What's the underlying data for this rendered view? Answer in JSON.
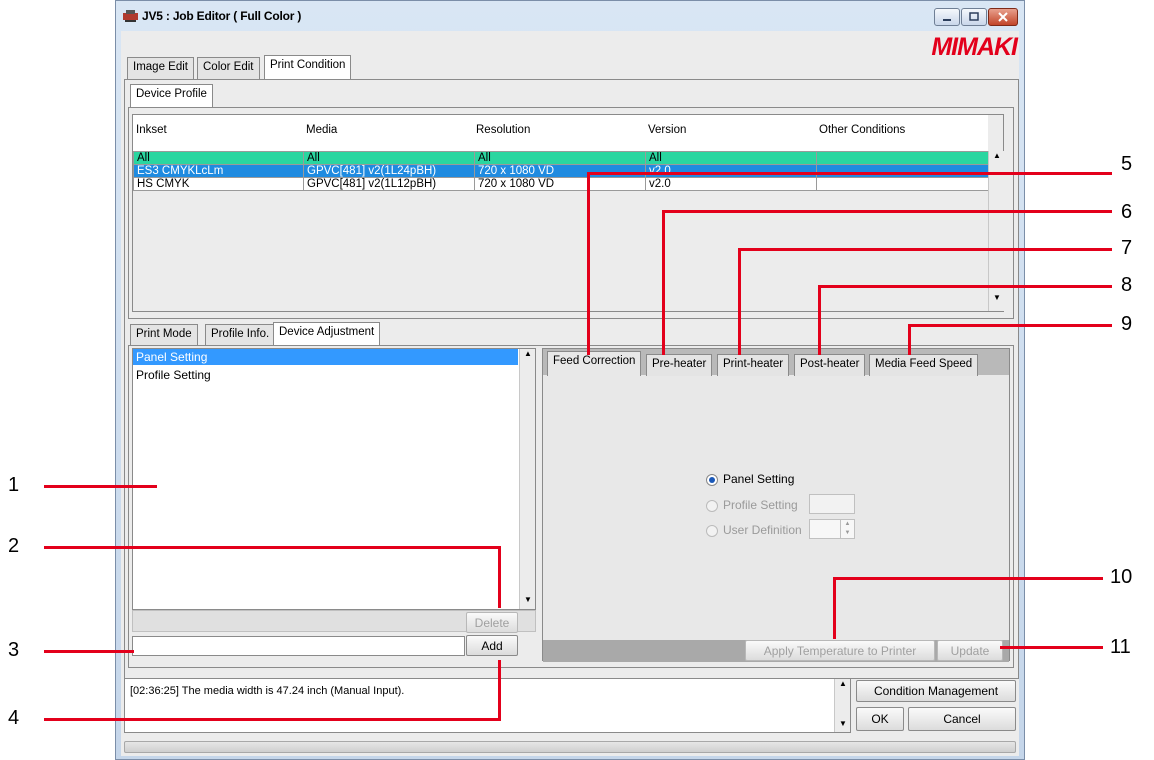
{
  "window": {
    "title": "JV5 : Job Editor ( Full Color )",
    "logo": "MIMAKI"
  },
  "main_tabs": [
    {
      "label": "Image Edit"
    },
    {
      "label": "Color Edit"
    },
    {
      "label": "Print Condition"
    }
  ],
  "sub_tab": {
    "label": "Device Profile"
  },
  "profile_table": {
    "columns": [
      "Inkset",
      "Media",
      "Resolution",
      "Version",
      "Other Conditions"
    ],
    "rows": [
      {
        "inkset": "All",
        "media": "All",
        "resolution": "All",
        "version": "All",
        "other": ""
      },
      {
        "inkset": "ES3 CMYKLcLm",
        "media": "GPVC[481] v2(1L24pBH)",
        "resolution": "720 x 1080 VD",
        "version": "v2.0",
        "other": ""
      },
      {
        "inkset": "HS CMYK",
        "media": "GPVC[481] v2(1L12pBH)",
        "resolution": "720 x 1080 VD",
        "version": "v2.0",
        "other": ""
      }
    ]
  },
  "lower_tabs": [
    {
      "label": "Print Mode"
    },
    {
      "label": "Profile Info."
    },
    {
      "label": "Device Adjustment"
    }
  ],
  "setting_list": {
    "items": [
      "Panel Setting",
      "Profile Setting"
    ]
  },
  "buttons": {
    "delete": "Delete",
    "add": "Add",
    "apply_temp": "Apply Temperature to Printer",
    "update": "Update",
    "condition_management": "Condition Management",
    "ok": "OK",
    "cancel": "Cancel"
  },
  "add_input": {
    "value": ""
  },
  "right_tabs": [
    {
      "label": "Feed Correction"
    },
    {
      "label": "Pre-heater"
    },
    {
      "label": "Print-heater"
    },
    {
      "label": "Post-heater"
    },
    {
      "label": "Media Feed Speed"
    }
  ],
  "feed_options": {
    "panel": "Panel Setting",
    "profile": "Profile Setting",
    "user": "User Definition",
    "selected": "Panel Setting"
  },
  "log": {
    "text": "[02:36:25] The media width is 47.24 inch (Manual Input)."
  },
  "callouts": [
    "1",
    "2",
    "3",
    "4",
    "5",
    "6",
    "7",
    "8",
    "9",
    "10",
    "11"
  ],
  "colors": {
    "accent_red": "#e3001b",
    "row_all": "#2ad6a0",
    "row_selected": "#1f8be0",
    "list_selected": "#3399ff"
  }
}
